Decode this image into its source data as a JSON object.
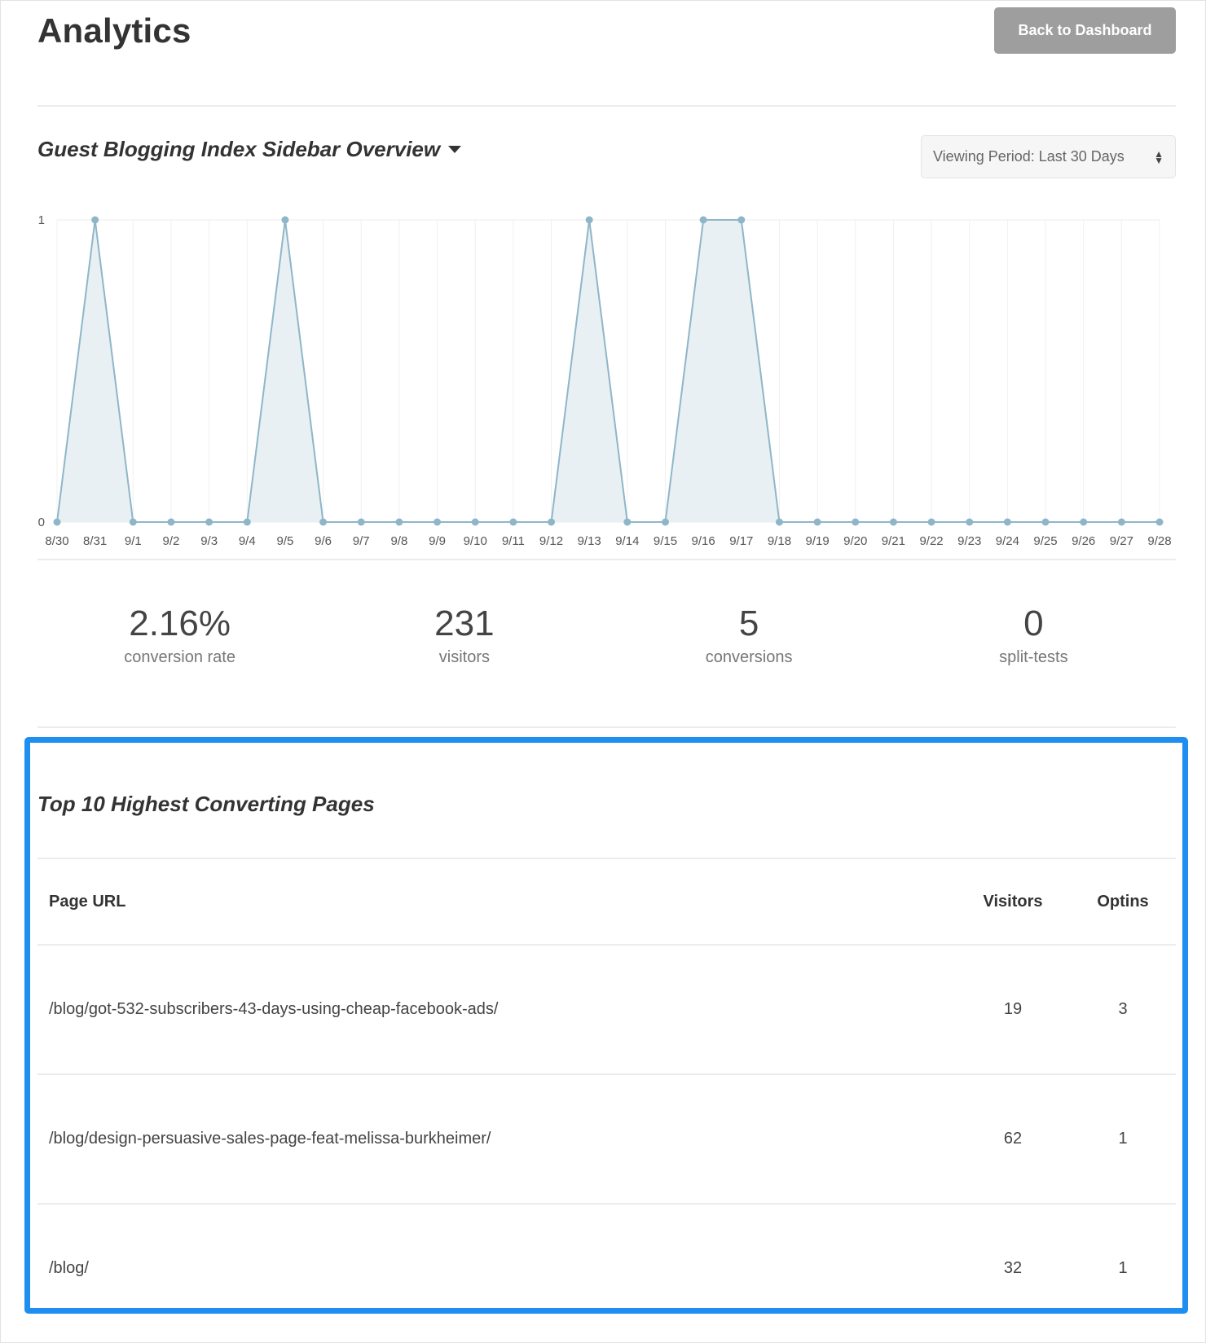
{
  "header": {
    "title": "Analytics",
    "back_button_label": "Back to Dashboard"
  },
  "overview": {
    "title": "Guest Blogging Index Sidebar Overview",
    "period_select": {
      "selected": "Viewing Period: Last 30 Days",
      "arrows_icon": "updown-arrows-icon"
    }
  },
  "chart_data": {
    "type": "area",
    "title": "",
    "xlabel": "",
    "ylabel": "",
    "x": [
      "8/30",
      "8/31",
      "9/1",
      "9/2",
      "9/3",
      "9/4",
      "9/5",
      "9/6",
      "9/7",
      "9/8",
      "9/9",
      "9/10",
      "9/11",
      "9/12",
      "9/13",
      "9/14",
      "9/15",
      "9/16",
      "9/17",
      "9/18",
      "9/19",
      "9/20",
      "9/21",
      "9/22",
      "9/23",
      "9/24",
      "9/25",
      "9/26",
      "9/27",
      "9/28"
    ],
    "values": [
      0,
      1,
      0,
      0,
      0,
      0,
      1,
      0,
      0,
      0,
      0,
      0,
      0,
      0,
      1,
      0,
      0,
      1,
      1,
      0,
      0,
      0,
      0,
      0,
      0,
      0,
      0,
      0,
      0,
      0
    ],
    "ylim": [
      0,
      1
    ],
    "yticks": [
      "0",
      "1"
    ],
    "grid": true,
    "legend": "none",
    "line_color": "#8fb6c8",
    "fill_color": "#e8f0f4",
    "point_color": "#8fb6c8"
  },
  "stats": [
    {
      "value": "2.16%",
      "label": "conversion rate"
    },
    {
      "value": "231",
      "label": "visitors"
    },
    {
      "value": "5",
      "label": "conversions"
    },
    {
      "value": "0",
      "label": "split-tests"
    }
  ],
  "top_pages": {
    "title": "Top 10 Highest Converting Pages",
    "columns": {
      "url": "Page URL",
      "visitors": "Visitors",
      "optins": "Optins"
    },
    "rows": [
      {
        "url": "/blog/got-532-subscribers-43-days-using-cheap-facebook-ads/",
        "visitors": "19",
        "optins": "3"
      },
      {
        "url": "/blog/design-persuasive-sales-page-feat-melissa-burkheimer/",
        "visitors": "62",
        "optins": "1"
      },
      {
        "url": "/blog/",
        "visitors": "32",
        "optins": "1"
      }
    ]
  },
  "colors": {
    "highlight_border": "#1e8ff0",
    "button_bg": "#9e9e9e"
  }
}
